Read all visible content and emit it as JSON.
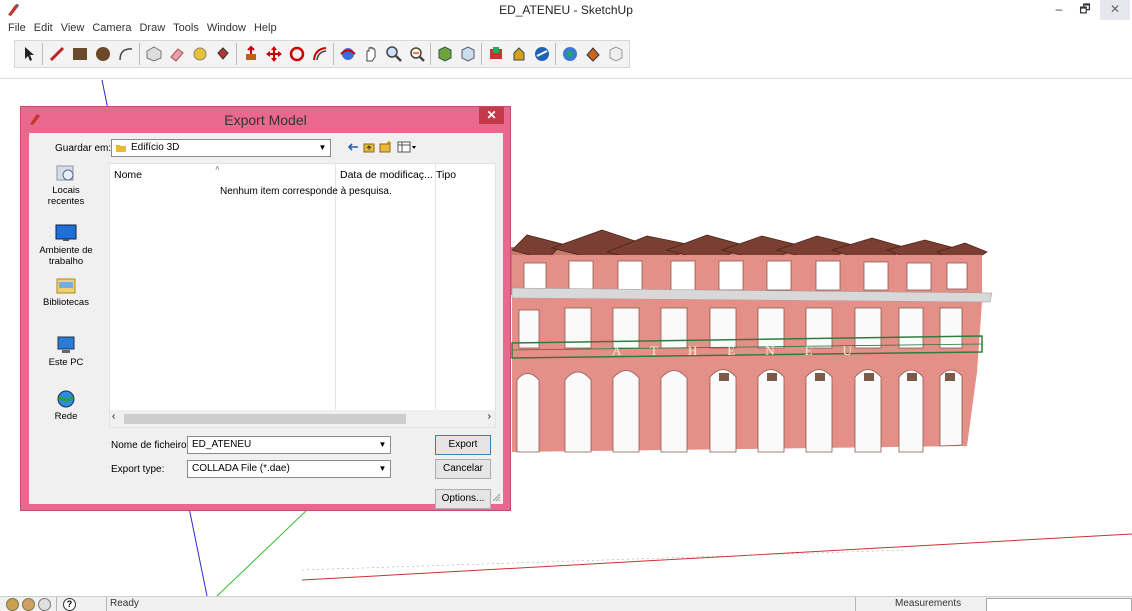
{
  "window": {
    "title": "ED_ATENEU - SketchUp",
    "minimize": "–",
    "maximize": "🗗",
    "close": "✕"
  },
  "menu": [
    "File",
    "Edit",
    "View",
    "Camera",
    "Draw",
    "Tools",
    "Window",
    "Help"
  ],
  "toolbar": {
    "icons": [
      "select",
      "line",
      "rectangle",
      "circle",
      "arc",
      "make-component",
      "eraser",
      "tape-measure",
      "paint-bucket",
      "push-pull",
      "move",
      "rotate",
      "offset",
      "orbit",
      "pan",
      "zoom",
      "zoom-extents",
      "previous-view",
      "3d-warehouse",
      "share-model",
      "get-models",
      "extension-warehouse",
      "style",
      "component",
      "add-location"
    ]
  },
  "dialog": {
    "title": "Export Model",
    "close": "✕",
    "save_in_label": "Guardar em:",
    "save_in_value": "Edifício 3D",
    "places": [
      "Locais recentes",
      "Ambiente de trabalho",
      "Bibliotecas",
      "Este PC",
      "Rede"
    ],
    "columns": [
      "Nome",
      "Data de modificaç...",
      "Tipo"
    ],
    "empty_message": "Nenhum item corresponde à pesquisa.",
    "filename_label": "Nome de ficheiro:",
    "filename_value": "ED_ATENEU",
    "export_type_label": "Export type:",
    "export_type_value": "COLLADA File (*.dae)",
    "export_button": "Export",
    "cancel_button": "Cancelar",
    "options_button": "Options..."
  },
  "model": {
    "sign_text": "ATHENEU"
  },
  "statusbar": {
    "status_text": "Ready",
    "measurements_label": "Measurements",
    "measurements_value": ""
  },
  "colors": {
    "dialog_frame": "#e8698d",
    "facade": "#e58f89",
    "roof": "#7a3f32"
  }
}
